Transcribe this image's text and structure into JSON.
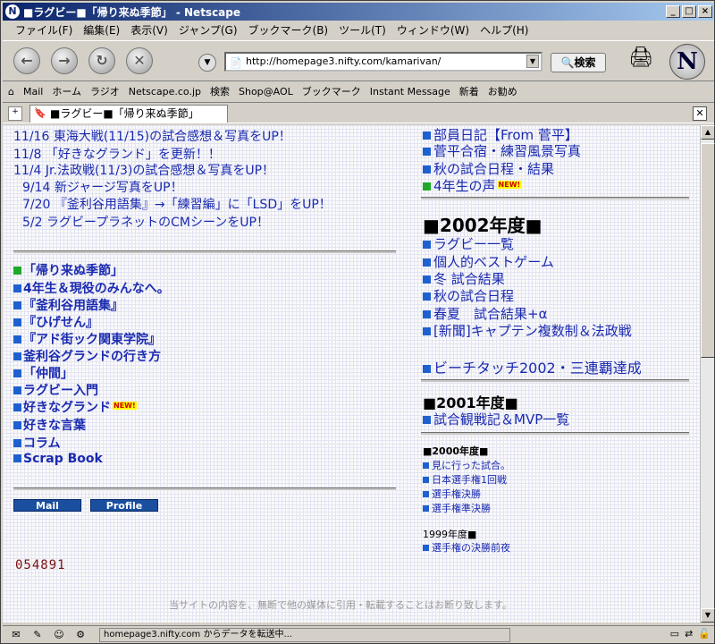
{
  "window": {
    "title": "■ラグビー■「帰り来ぬ季節」 - Netscape"
  },
  "menu": [
    "ファイル(F)",
    "編集(E)",
    "表示(V)",
    "ジャンプ(G)",
    "ブックマーク(B)",
    "ツール(T)",
    "ウィンドウ(W)",
    "ヘルプ(H)"
  ],
  "nav": {
    "url": "http://homepage3.nifty.com/kamarivan/",
    "search_label": "検索"
  },
  "personal_bar": [
    "Mail",
    "ホーム",
    "ラジオ",
    "Netscape.co.jp",
    "検索",
    "Shop@AOL",
    "ブックマーク",
    "Instant Message",
    "新着",
    "お勧め"
  ],
  "tab": {
    "title": "■ラグビー■「帰り来ぬ季節」"
  },
  "news": [
    {
      "date": "11/16",
      "text": "東海大戦(11/15)の試合感想＆写真をUP！"
    },
    {
      "date": "11/8",
      "text": "「好きなグランド」を更新！！"
    },
    {
      "date": "11/4",
      "text": "Jr.法政戦(11/3)の試合感想＆写真をUP！"
    },
    {
      "date": "9/14",
      "text": "新ジャージ写真をUP！"
    },
    {
      "date": "7/20",
      "text": "『釜利谷用語集』→「練習編」に「LSD」をUP！"
    },
    {
      "date": "5/2",
      "text": "ラグビープラネットのCMシーンをUP！"
    }
  ],
  "left_links": [
    "「帰り来ぬ季節」",
    "4年生＆現役のみんなへ。",
    "『釜利谷用語集』",
    "『ひげせん』",
    "『アド街ック関東学院』",
    "釜利谷グランドの行き方",
    "「仲間」",
    "ラグビー入門",
    "好きなグランド",
    "好きな言葉",
    "コラム",
    "Scrap Book"
  ],
  "new_tag": "NEW!",
  "buttons": {
    "mail": "Mail",
    "profile": "Profile"
  },
  "counter": "054891",
  "right_top": [
    "部員日記【From 菅平】",
    "菅平合宿・練習風景写真",
    "秋の試合日程・結果",
    "4年生の声"
  ],
  "section2002": {
    "title": "2002年度",
    "items": [
      "ラグビー一覧",
      "個人的ベストゲーム",
      "冬 試合結果",
      "秋の試合日程",
      "春夏　試合結果+α",
      "[新聞]キャプテン複数制＆法政戦",
      "ビーチタッチ2002・三連覇達成"
    ]
  },
  "section2001": {
    "title": "2001年度",
    "items": [
      "試合観戦記＆MVP一覧"
    ]
  },
  "section2000": {
    "title": "2000年度",
    "items": [
      "見に行った試合。",
      "日本選手権1回戦",
      "選手権決勝",
      "選手権準決勝"
    ]
  },
  "section1999": {
    "title": "1999年度",
    "items": [
      "選手権の決勝前夜"
    ]
  },
  "footer": "当サイトの内容を、無断で他の媒体に引用・転載することはお断り致します。",
  "status": {
    "text": "homepage3.nifty.com からデータを転送中..."
  }
}
